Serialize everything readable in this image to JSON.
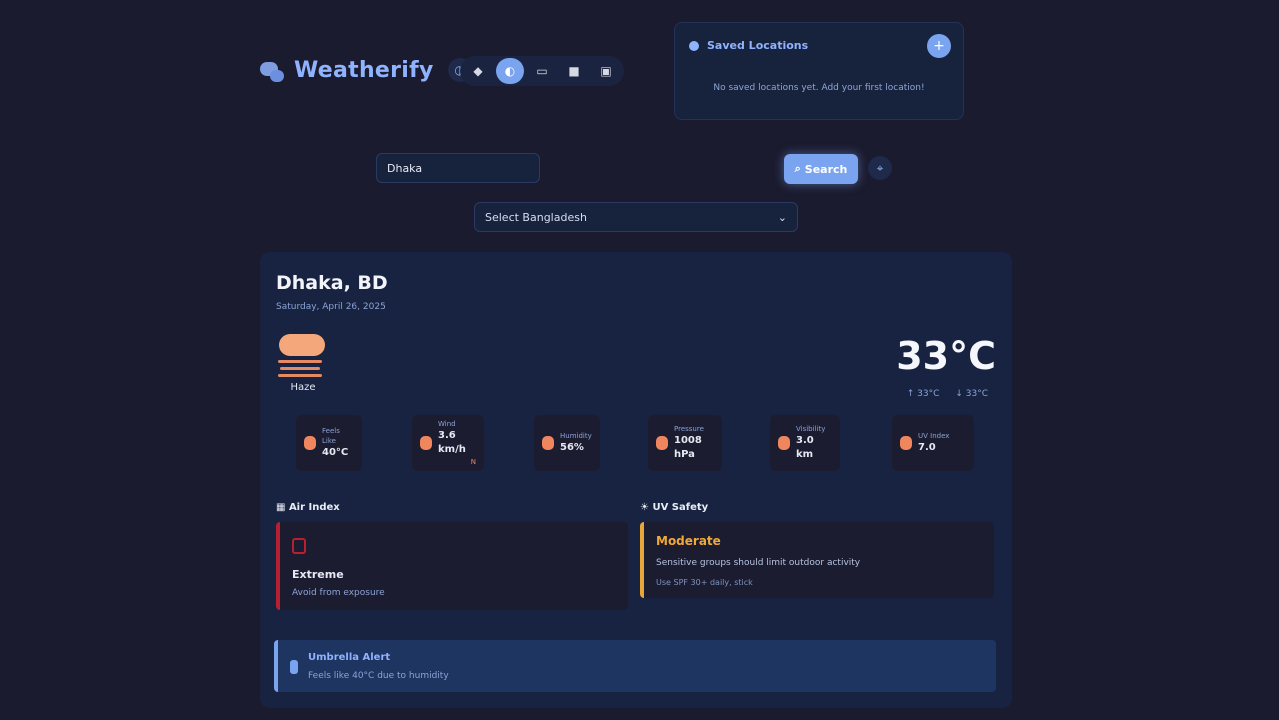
{
  "app": {
    "name": "Weatherify"
  },
  "header": {
    "theme_toggle_icon": "contrast-icon",
    "themes": [
      {
        "icon": "palette-icon-1",
        "glyph": "◆",
        "active": false
      },
      {
        "icon": "palette-icon-2",
        "glyph": "◐",
        "active": true
      },
      {
        "icon": "palette-icon-3",
        "glyph": "▭",
        "active": false
      },
      {
        "icon": "palette-icon-4",
        "glyph": "■",
        "active": false
      },
      {
        "icon": "palette-icon-5",
        "glyph": "▣",
        "active": false
      }
    ]
  },
  "saved_locations": {
    "title": "Saved Locations",
    "add_label": "+",
    "empty_text": "No saved locations yet. Add your first location!"
  },
  "search": {
    "value": "Dhaka",
    "button_label": "Search",
    "location_icon": "crosshair-icon"
  },
  "select": {
    "value": "Select Bangladesh"
  },
  "current": {
    "city": "Dhaka, BD",
    "date": "Saturday, April 26, 2025",
    "condition": "Haze",
    "temperature": "33°C",
    "high": "↑ 33°C",
    "low": "↓ 33°C"
  },
  "stats": [
    {
      "icon": "thermometer-icon",
      "label": "Feels Like",
      "value": "40°C"
    },
    {
      "icon": "wind-icon",
      "label": "Wind",
      "value": "3.6 km/h",
      "extra": "N"
    },
    {
      "icon": "droplet-icon",
      "label": "Humidity",
      "value": "56%"
    },
    {
      "icon": "gauge-icon",
      "label": "Pressure",
      "value": "1008 hPa"
    },
    {
      "icon": "eye-icon",
      "label": "Visibility",
      "value": "3.0 km"
    },
    {
      "icon": "sun-icon",
      "label": "UV Index",
      "value": "7.0"
    }
  ],
  "air_quality": {
    "heading": "Air Index",
    "level": "Extreme",
    "description": "Avoid from exposure",
    "color": "#b72030"
  },
  "uv": {
    "heading": "UV Safety",
    "level": "Moderate",
    "description": "Sensitive groups should limit outdoor activity",
    "recommendation": "Use SPF 30+ daily, stick",
    "color": "#e8a53a"
  },
  "tip": {
    "title": "Umbrella Alert",
    "text": "Feels like 40°C due to humidity"
  },
  "colors": {
    "background": "#1b1b2f",
    "card": "#172341",
    "accent": "#7aa4ef",
    "icon_warm": "#f0865e"
  }
}
